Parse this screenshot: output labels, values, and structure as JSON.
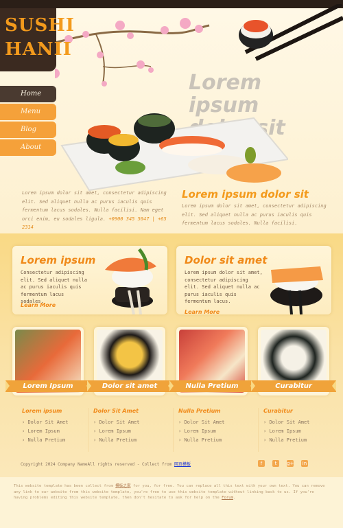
{
  "logo": {
    "line1": "SUSHI",
    "line2": "HANII"
  },
  "nav": [
    {
      "label": "Home",
      "active": true
    },
    {
      "label": "Menu",
      "active": false
    },
    {
      "label": "Blog",
      "active": false
    },
    {
      "label": "About",
      "active": false
    }
  ],
  "hero": {
    "title_line1": "Lorem ipsum",
    "title_line2": "dolor sit amet!",
    "left_text": "Lorem ipsum dolor sit amet, consectetur adipiscing elit. Sed aliquet nulla ac purus iaculis quis fermentum lacus sodales. Nulla facilisi. Nam eget orci enim, eu sodales ligula.",
    "phone": "+0900 345 5647 | +65 2314",
    "right_title": "Lorem ipsum dolor sit",
    "right_text": "Lorem ipsum dolor sit amet, consectetur adipiscing elit. Sed aliquet nulla ac purus iaculis quis fermentum lacus sodales. Nulla facilisi."
  },
  "features": [
    {
      "title": "Lorem ipsum",
      "text": "Consectetur adipiscing elit. Sed aliquet nulla ac purus iaculis quis fermentum lacus sodales.",
      "link": "Learn More"
    },
    {
      "title": "Dolor sit amet",
      "text": "Lorem ipsum dolor sit amet, consectetur adipiscing elit. Sed aliquet nulla ac purus iaculis quis fermentum lacus.",
      "link": "Learn More"
    }
  ],
  "gallery": [
    {
      "label": "Lorem Ipsum"
    },
    {
      "label": "Dolor sit amet"
    },
    {
      "label": "Nulla Pretium"
    },
    {
      "label": "Curabitur"
    }
  ],
  "footer_columns": [
    {
      "title": "Lorem ipsum",
      "items": [
        "Dolor Sit Amet",
        "Lorem Ipsum",
        "Nulla Pretium"
      ]
    },
    {
      "title": "Dolor Sit Amet",
      "items": [
        "Dolor Sit Amet",
        "Lorem Ipsum",
        "Nulla Pretium"
      ]
    },
    {
      "title": "Nulla Pretium",
      "items": [
        "Dolor Sit Amet",
        "Lorem Ipsum",
        "Nulla Pretium"
      ]
    },
    {
      "title": "Curabitur",
      "items": [
        "Dolor Sit Amet",
        "Lorem Ipsum",
        "Nulla Pretium"
      ]
    }
  ],
  "copyright": {
    "text": "Copyright 2024 Company NameAll rights reserved - Collect from",
    "link": "网页模板"
  },
  "social": [
    "f",
    "t",
    "g+",
    "in"
  ],
  "bottom_note": {
    "before": "This website template has been collect from",
    "link1": "模板之家",
    "middle": "for you, for free. You can replace all this text with your own text. You can remove any link to our website from this website template, you're free to use this website template without linking back to us. If you're having problems editing this website template, then don't hesitate to ask for help on the",
    "link2": "Forum",
    "after": "."
  },
  "colors": {
    "accent": "#f39a1c",
    "dark": "#3b2a20",
    "nav": "#f5a13a"
  }
}
